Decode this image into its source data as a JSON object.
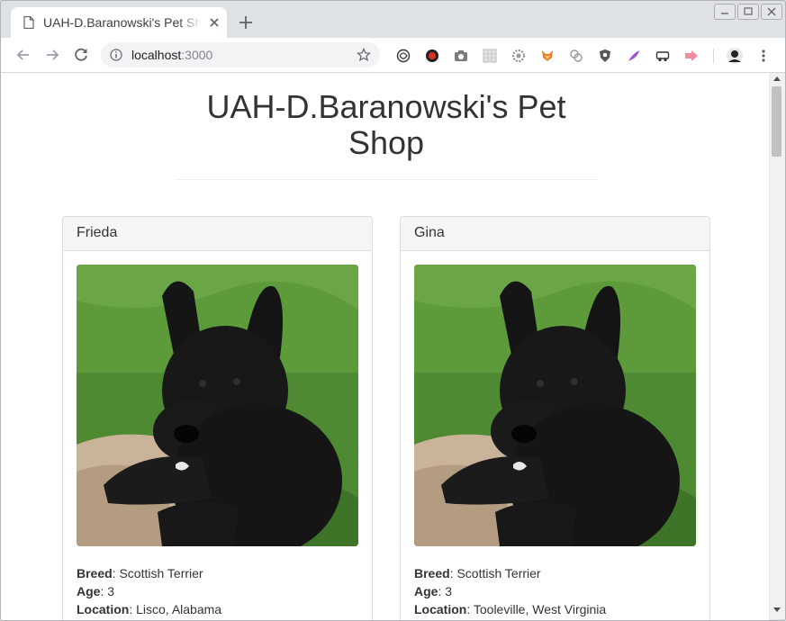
{
  "browser": {
    "tab_title": "UAH-D.Baranowski's Pet Shop",
    "url_host": "localhost",
    "url_port": ":3000",
    "icons": [
      "page-icon",
      "close-icon",
      "new-tab-icon",
      "back-icon",
      "forward-icon",
      "reload-icon",
      "info-icon",
      "star-icon"
    ],
    "extensions": [
      "spiral-ext-icon",
      "red-circle-ext-icon",
      "camera-ext-icon",
      "grid-ext-icon",
      "gear-ext-icon",
      "fox-ext-icon",
      "links-ext-icon",
      "shield-ext-icon",
      "feather-ext-icon",
      "car-ext-icon",
      "arrow-ext-icon",
      "profile-avatar",
      "menu-dots-icon"
    ]
  },
  "page": {
    "title": "UAH-D.Baranowski's Pet Shop"
  },
  "colors": {
    "text": "#333333",
    "card_header_bg": "#f5f5f5",
    "card_border": "#dddddd"
  },
  "pets": [
    {
      "name": "Frieda",
      "breed_label": "Breed",
      "breed": "Scottish Terrier",
      "age_label": "Age",
      "age": "3",
      "location_label": "Location",
      "location": "Lisco, Alabama",
      "photo": "black-scottish-terrier-puppy"
    },
    {
      "name": "Gina",
      "breed_label": "Breed",
      "breed": "Scottish Terrier",
      "age_label": "Age",
      "age": "3",
      "location_label": "Location",
      "location": "Tooleville, West Virginia",
      "photo": "black-scottish-terrier-puppy"
    }
  ],
  "separator": ": "
}
